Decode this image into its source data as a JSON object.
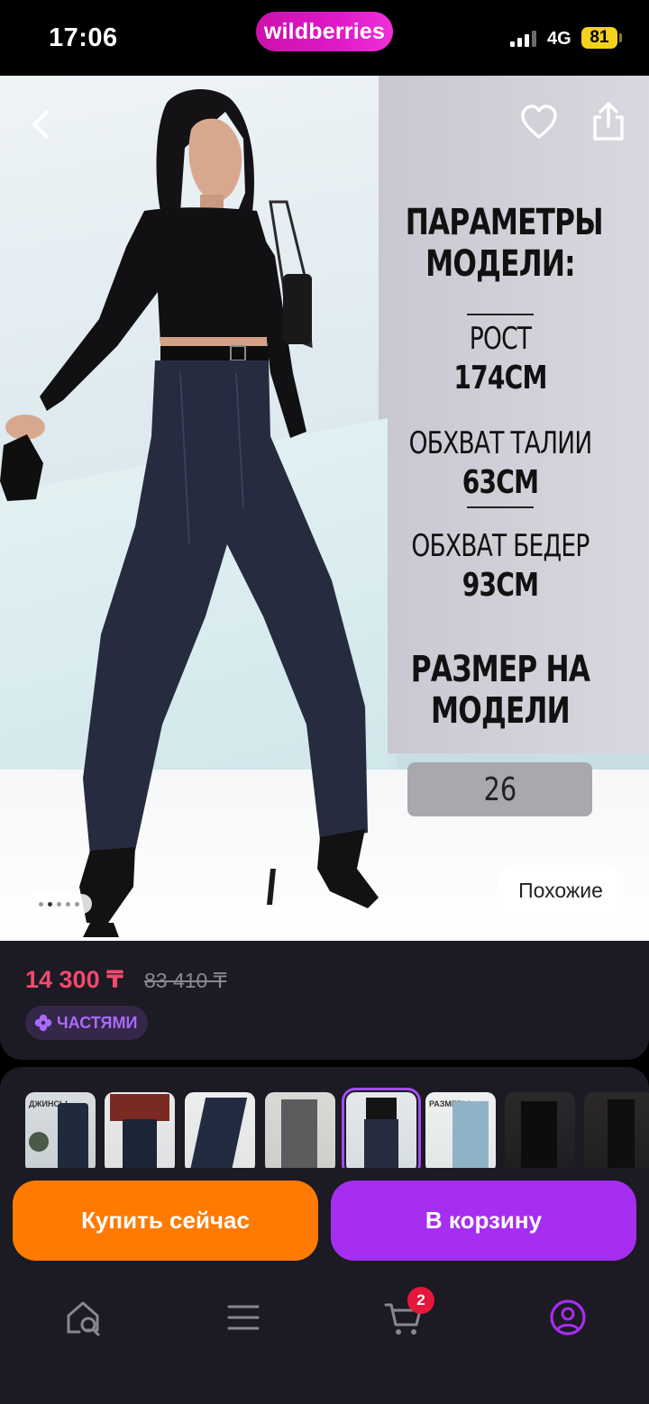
{
  "status_bar": {
    "time": "17:06",
    "brand": "wildberries",
    "network": "4G",
    "battery": "81"
  },
  "photo": {
    "params_title": "ПАРАМЕТРЫ МОДЕЛИ:",
    "height_label": "РОСТ",
    "height_value": "174СМ",
    "waist_label": "ОБХВАТ ТАЛИИ",
    "waist_value": "63СМ",
    "hips_label": "ОБХВАТ БЕДЕР",
    "hips_value": "93СМ",
    "size_title": "РАЗМЕР НА МОДЕЛИ",
    "size_value": "26",
    "similar_label": "Похожие",
    "icons": [
      "back-icon",
      "heart-icon",
      "share-icon"
    ]
  },
  "product": {
    "price": "14 300 ₸",
    "old_price": "83 410 ₸",
    "installments_label": "ЧАСТЯМИ"
  },
  "thumbnails": {
    "first_caption": "ДЖИНСЫ",
    "sixth_caption": "РАЗМЕРЫ",
    "selected_index": 4
  },
  "actions": {
    "buy_now_label": "Купить сейчас",
    "add_to_cart_label": "В корзину"
  },
  "bottom_nav": {
    "cart_badge": "2",
    "items": [
      "home-search-icon",
      "menu-icon",
      "cart-icon",
      "profile-icon"
    ],
    "active_color": "#a52ef0"
  },
  "colors": {
    "brand": "#cb11ab",
    "price": "#f24a6f",
    "buy": "#ff7a00",
    "cart": "#a52ef0"
  }
}
